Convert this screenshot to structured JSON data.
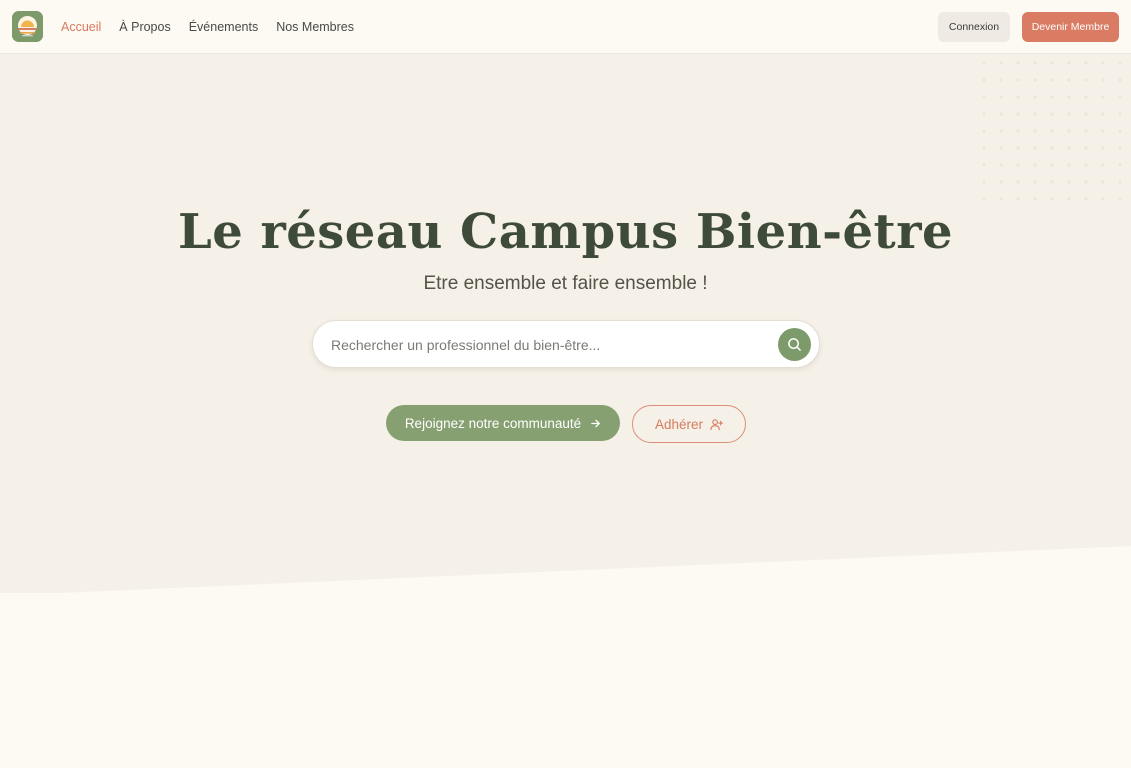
{
  "nav": {
    "links": [
      {
        "label": "Accueil",
        "active": true
      },
      {
        "label": "À Propos",
        "active": false
      },
      {
        "label": "Événements",
        "active": false
      },
      {
        "label": "Nos Membres",
        "active": false
      }
    ],
    "login_label": "Connexion",
    "become_member_label": "Devenir Membre"
  },
  "logo": {
    "icon": "sunrise-logo-icon"
  },
  "hero": {
    "title": "Le réseau Campus Bien-être",
    "subtitle": "Etre ensemble et faire ensemble !",
    "search": {
      "placeholder": "Rechercher un professionnel du bien-être...",
      "value": "",
      "icon": "search-icon"
    },
    "join_label": "Rejoignez notre communauté",
    "join_icon": "arrow-right-icon",
    "adherer_label": "Adhérer",
    "adherer_icon": "user-plus-icon"
  },
  "colors": {
    "accent_green": "#7d9a6b",
    "accent_coral": "#d97c63",
    "hero_bg": "#f5f1e8",
    "page_bg": "#fdf9f3",
    "title_color": "#3e4b3a"
  }
}
